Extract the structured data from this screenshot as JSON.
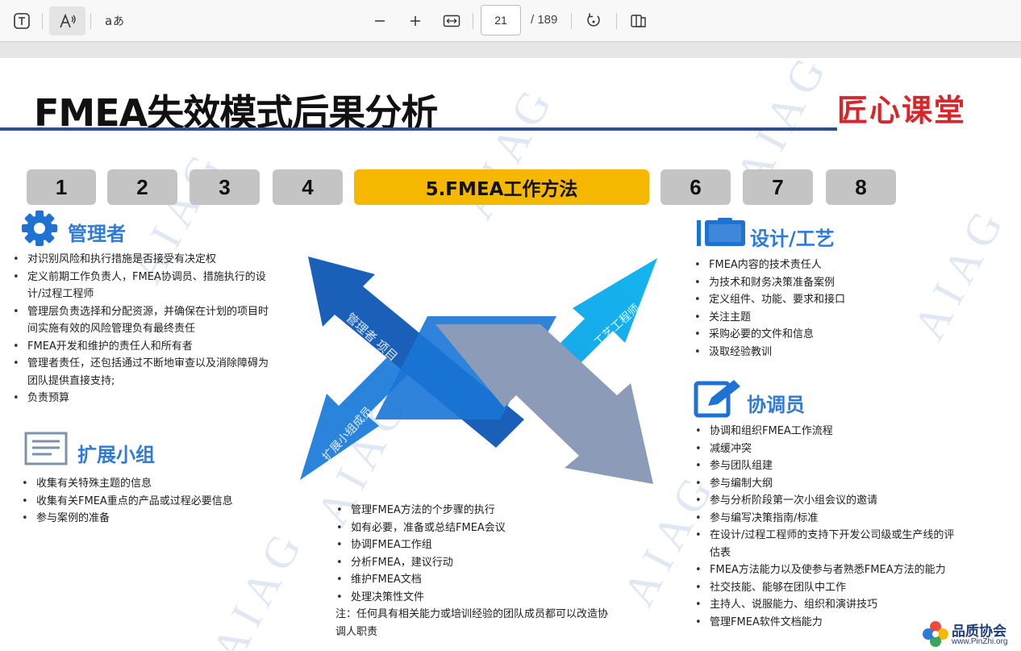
{
  "viewer": {
    "page_current": "21",
    "page_total": "/ 189"
  },
  "slide": {
    "title": "FMEA失效模式后果分析",
    "logo_text": "匠心课堂",
    "watermark": "AIAG",
    "steps": [
      "1",
      "2",
      "3",
      "4",
      "5.FMEA工作方法",
      "6",
      "7",
      "8"
    ],
    "sections": {
      "manager": {
        "title": "管理者",
        "items": [
          "对识别风险和执行措施是否接受有决定权",
          "定义前期工作负责人，FMEA协调员、措施执行的设",
          "计/过程工程师",
          "管理层负责选择和分配资源，并确保在计划的项目时",
          "间实施有效的风险管理负有最终责任",
          "FMEA开发和维护的责任人和所有者",
          "管理者责任，还包括通过不断地审查以及消除障碍为",
          "团队提供直接支持;",
          "负责预算"
        ]
      },
      "extended": {
        "title": "扩展小组",
        "items": [
          "收集有关特殊主题的信息",
          "收集有关FMEA重点的产品或过程必要信息",
          "参与案例的准备"
        ]
      },
      "design": {
        "title": "设计/工艺",
        "items": [
          "FMEA内容的技术责任人",
          "为技术和财务决策准备案例",
          "定义组件、功能、要求和接口",
          "关注主题",
          "采购必要的文件和信息",
          "汲取经验教训"
        ]
      },
      "coordinator": {
        "title": "协调员",
        "items": [
          "协调和组织FMEA工作流程",
          "减缓冲突",
          "参与团队组建",
          "参与编制大纲",
          "参与分析阶段第一次小组会议的邀请",
          "参与编写决策指南/标准",
          "在设计/过程工程师的支持下开发公司级或生产线的评",
          "估表",
          "FMEA方法能力以及使参与者熟悉FMEA方法的能力",
          "社交技能、能够在团队中工作",
          "主持人、说服能力、组织和演讲技巧",
          "管理FMEA软件文档能力"
        ]
      },
      "center": {
        "items": [
          "管理FMEA方法的个步骤的执行",
          "如有必要，准备或总结FMEA会议",
          "协调FMEA工作组",
          "分析FMEA，建议行动",
          "维护FMEA文档",
          "处理决策性文件"
        ],
        "note_line1": "注：任何具有相关能力或培训经验的团队成员都可以改造协",
        "note_line2": "调人职责"
      }
    },
    "arrows": {
      "top_left": "管理者 项目",
      "top_right": "工艺工程师",
      "bottom_left": "扩展小组成员"
    },
    "corner": {
      "title": "品质协会",
      "url": "www.PinZhi.org"
    }
  }
}
